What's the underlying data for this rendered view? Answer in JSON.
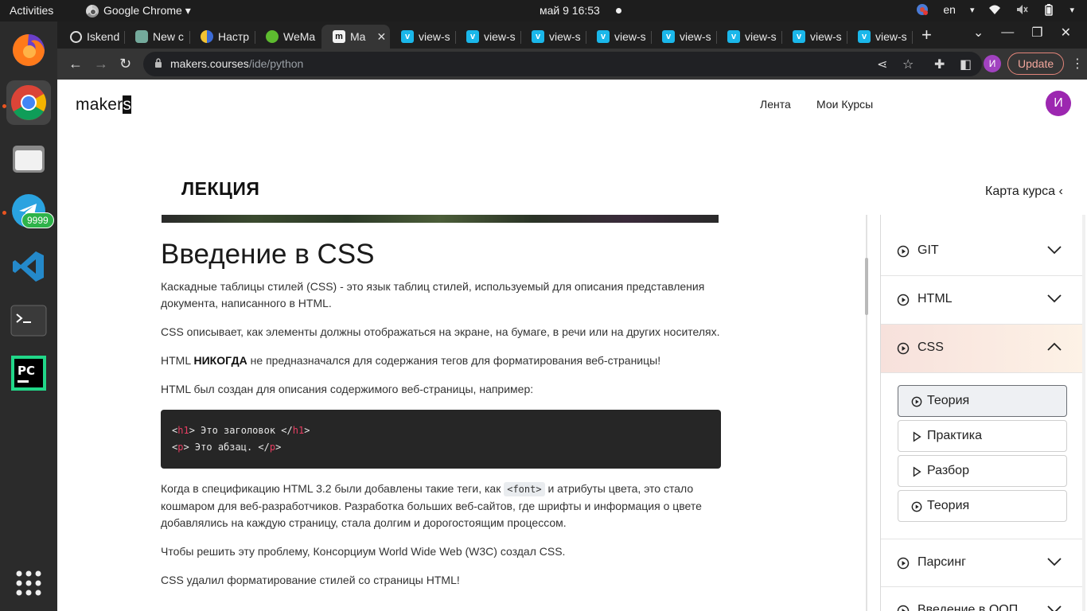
{
  "system_bar": {
    "activities": "Activities",
    "app_name": "Google Chrome ▾",
    "clock": "май 9  16:53",
    "language": "en"
  },
  "browser": {
    "tabs": [
      {
        "label": "Iskend",
        "favicon": "github-icon"
      },
      {
        "label": "New c",
        "favicon": "chatgpt-icon"
      },
      {
        "label": "Настр",
        "favicon": "settings-favicon"
      },
      {
        "label": "WeMa",
        "favicon": "globe-green-icon"
      },
      {
        "label": "Ma",
        "favicon": "makers-m-icon",
        "active": true
      },
      {
        "label": "view-s",
        "favicon": "vimeo-icon"
      },
      {
        "label": "view-s",
        "favicon": "vimeo-icon"
      },
      {
        "label": "view-s",
        "favicon": "vimeo-icon"
      },
      {
        "label": "view-s",
        "favicon": "vimeo-icon"
      },
      {
        "label": "view-s",
        "favicon": "vimeo-icon"
      },
      {
        "label": "view-s",
        "favicon": "vimeo-icon"
      },
      {
        "label": "view-s",
        "favicon": "vimeo-icon"
      },
      {
        "label": "view-s",
        "favicon": "vimeo-icon"
      }
    ],
    "url_host": "makers.courses",
    "url_path": "/ide/python",
    "update_label": "Update",
    "profile_initial": "И"
  },
  "dock": {
    "telegram_badge": "9999"
  },
  "site": {
    "logo_main": "maker",
    "logo_cursor": "s",
    "nav": [
      "Лента",
      "Мои Курсы"
    ],
    "avatar_initial": "И"
  },
  "page": {
    "section_label": "ЛЕКЦИЯ",
    "map_link": "Карта курса ‹"
  },
  "article": {
    "title": "Введение в CSS",
    "p1": "Каскадные таблицы стилей (CSS) - это язык таблиц стилей, используемый для описания представления документа, написанного в HTML.",
    "p2": "CSS описывает, как элементы должны отображаться на экране, на бумаге, в речи или на других носителях.",
    "p3_before": "HTML ",
    "p3_bold": "НИКОГДА",
    "p3_after": " не предназначался для содержания тегов для форматирования веб-страницы!",
    "p4": "HTML был создан для описания содержимого веб-страницы, например:",
    "code_line1": {
      "open_lt": "<",
      "open_tag": "h1",
      "open_gt": ">",
      "text": " Это заголовок ",
      "close_lt": "</",
      "close_tag": "h1",
      "close_gt": ">"
    },
    "code_line2": {
      "open_lt": "<",
      "open_tag": "p",
      "open_gt": ">",
      "text": " Это абзац. ",
      "close_lt": "</",
      "close_tag": "p",
      "close_gt": ">"
    },
    "p5_before": "Когда в спецификацию HTML 3.2 были добавлены такие теги, как ",
    "p5_code": "<font>",
    "p5_after": " и атрибуты цвета, это стало кошмаром для веб-разработчиков. Разработка больших веб-сайтов, где шрифты и информация о цвете добавлялись на каждую страницу, стала долгим и дорогостоящим процессом.",
    "p6": "Чтобы решить эту проблему, Консорциум World Wide Web (W3C) создал CSS.",
    "p7": "CSS удалил форматирование стилей со страницы HTML!"
  },
  "course_map": {
    "sections": [
      {
        "label": "GIT",
        "expanded": false
      },
      {
        "label": "HTML",
        "expanded": false
      },
      {
        "label": "CSS",
        "expanded": true
      },
      {
        "label": "Парсинг",
        "expanded": false
      },
      {
        "label": "Введение в ООП",
        "expanded": false
      }
    ],
    "lessons": [
      {
        "label": "Теория",
        "icon": "play-circle-icon",
        "selected": true
      },
      {
        "label": "Практика",
        "icon": "play-triangle-icon"
      },
      {
        "label": "Разбор",
        "icon": "play-triangle-icon"
      },
      {
        "label": "Теория",
        "icon": "play-circle-icon"
      }
    ]
  },
  "colors": {
    "accent_avatar": "#9c27b0",
    "active_section_bg": "#f7e1dc",
    "code_tag": "#e83e62",
    "update_border": "#e3857a"
  }
}
